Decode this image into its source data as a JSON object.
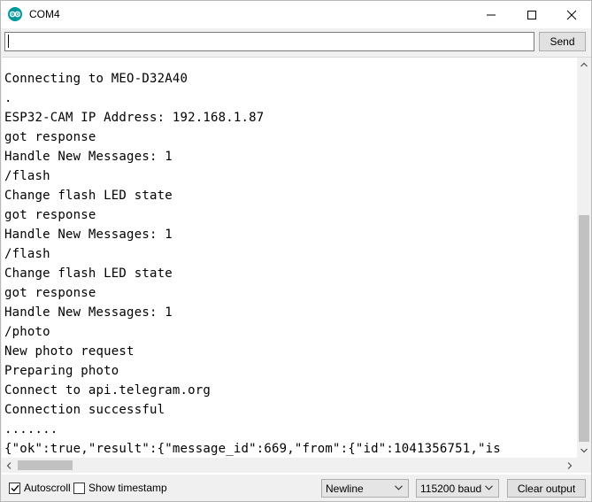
{
  "window": {
    "title": "COM4",
    "icons": {
      "app": "arduino-icon",
      "minimize": "minimize-icon",
      "maximize": "maximize-icon",
      "close": "close-icon"
    }
  },
  "toolbar": {
    "input_value": "",
    "send_label": "Send"
  },
  "output": {
    "lines": [
      "Connecting to MEO-D32A40",
      ".",
      "ESP32-CAM IP Address: 192.168.1.87",
      "got response",
      "Handle New Messages: 1",
      "/flash",
      "Change flash LED state",
      "got response",
      "Handle New Messages: 1",
      "/flash",
      "Change flash LED state",
      "got response",
      "Handle New Messages: 1",
      "/photo",
      "New photo request",
      "Preparing photo",
      "Connect to api.telegram.org",
      "Connection successful",
      ".......",
      "{\"ok\":true,\"result\":{\"message_id\":669,\"from\":{\"id\":1041356751,\"is"
    ]
  },
  "statusbar": {
    "autoscroll_label": "Autoscroll",
    "autoscroll_checked": true,
    "timestamp_label": "Show timestamp",
    "timestamp_checked": false,
    "line_ending": "Newline",
    "baud_rate": "115200 baud",
    "clear_label": "Clear output"
  },
  "colors": {
    "accent": "#00979c",
    "scroll_thumb": "#c1c1c1"
  }
}
